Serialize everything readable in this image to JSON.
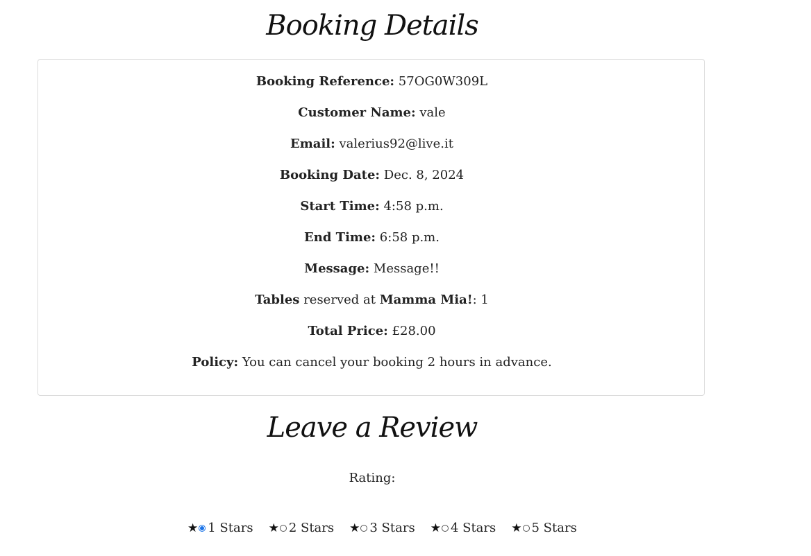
{
  "booking": {
    "title": "Booking Details",
    "reference_label": "Booking Reference:",
    "reference": "57OG0W309L",
    "name_label": "Customer Name:",
    "name": "vale",
    "email_label": "Email:",
    "email": "valerius92@live.it",
    "date_label": "Booking Date:",
    "date": "Dec. 8, 2024",
    "start_label": "Start Time:",
    "start": "4:58 p.m.",
    "end_label": "End Time:",
    "end": "6:58 p.m.",
    "message_label": "Message:",
    "message": "Message!!",
    "tables_label": "Tables",
    "tables_mid": "reserved at",
    "restaurant": "Mamma Mia!",
    "tables_count": ": 1",
    "price_label": "Total Price:",
    "price": "£28.00",
    "policy_label": "Policy:",
    "policy": "You can cancel your booking 2 hours in advance."
  },
  "review": {
    "title": "Leave a Review",
    "rating_label": "Rating:",
    "star_glyph": "★",
    "options": [
      {
        "label": "1 Stars",
        "checked": true
      },
      {
        "label": "2 Stars",
        "checked": false
      },
      {
        "label": "3 Stars",
        "checked": false
      },
      {
        "label": "4 Stars",
        "checked": false
      },
      {
        "label": "5 Stars",
        "checked": false
      }
    ]
  }
}
